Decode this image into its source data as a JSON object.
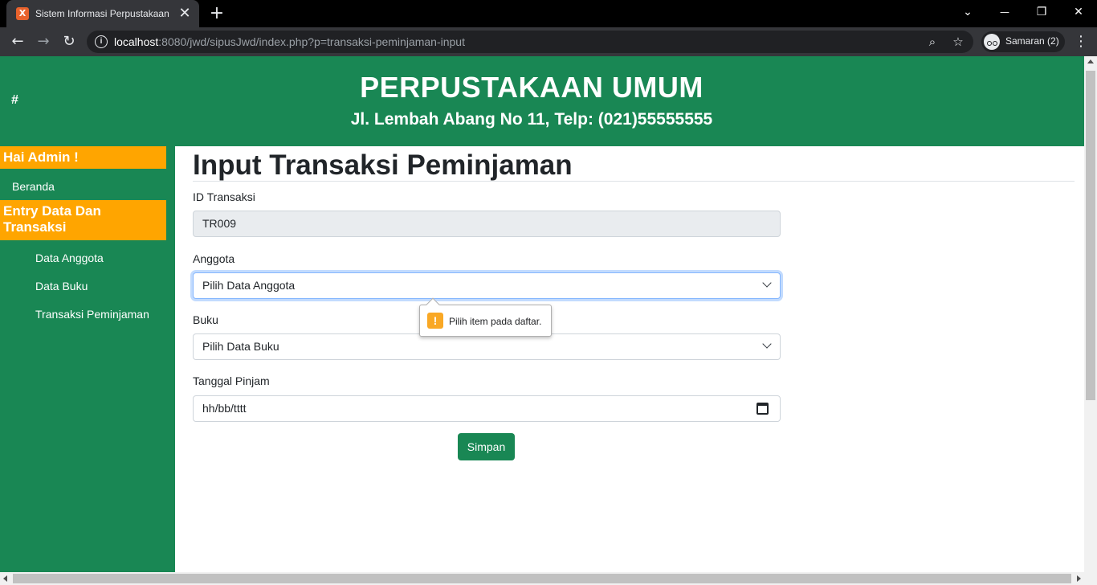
{
  "browser": {
    "tab_title": "Sistem Informasi Perpustakaan",
    "tab_favicon_letter": "X",
    "tab_close_symbol": "✕",
    "new_tab_symbol": "+",
    "url_host": "localhost",
    "url_rest": ":8080/jwd/sipusJwd/index.php?p=transaksi-peminjaman-input",
    "profile_label": "Samaran (2)",
    "window_controls": {
      "dropdown": "⌄",
      "minimize": "—",
      "restore": "❐",
      "close": "✕"
    },
    "nav": {
      "back": "←",
      "forward": "→",
      "reload": "↻",
      "zoom": "⌕",
      "bookmark": "☆",
      "menu": "⋮",
      "info": "i"
    }
  },
  "header": {
    "hash_link": "#",
    "title": "PERPUSTAKAAN UMUM",
    "subtitle": "Jl. Lembah Abang No 11, Telp: (021)55555555"
  },
  "sidebar": {
    "greeting": "Hai Admin !",
    "home_link": "Beranda",
    "section_heading": "Entry Data Dan Transaksi",
    "items": [
      "Data Anggota",
      "Data Buku",
      "Transaksi Peminjaman"
    ]
  },
  "form": {
    "page_title": "Input Transaksi Peminjaman",
    "id_label": "ID Transaksi",
    "id_value": "TR009",
    "member_label": "Anggota",
    "member_value": "Pilih Data Anggota",
    "book_label": "Buku",
    "book_value": "Pilih Data Buku",
    "date_label": "Tanggal Pinjam",
    "date_placeholder": "hh/bb/tttt",
    "submit_label": "Simpan"
  },
  "validation_tooltip": {
    "icon": "!",
    "text": "Pilih item pada daftar."
  },
  "colors": {
    "brand_green": "#198754",
    "accent_orange": "#ffa500",
    "warning_yellow": "#f9a825"
  }
}
